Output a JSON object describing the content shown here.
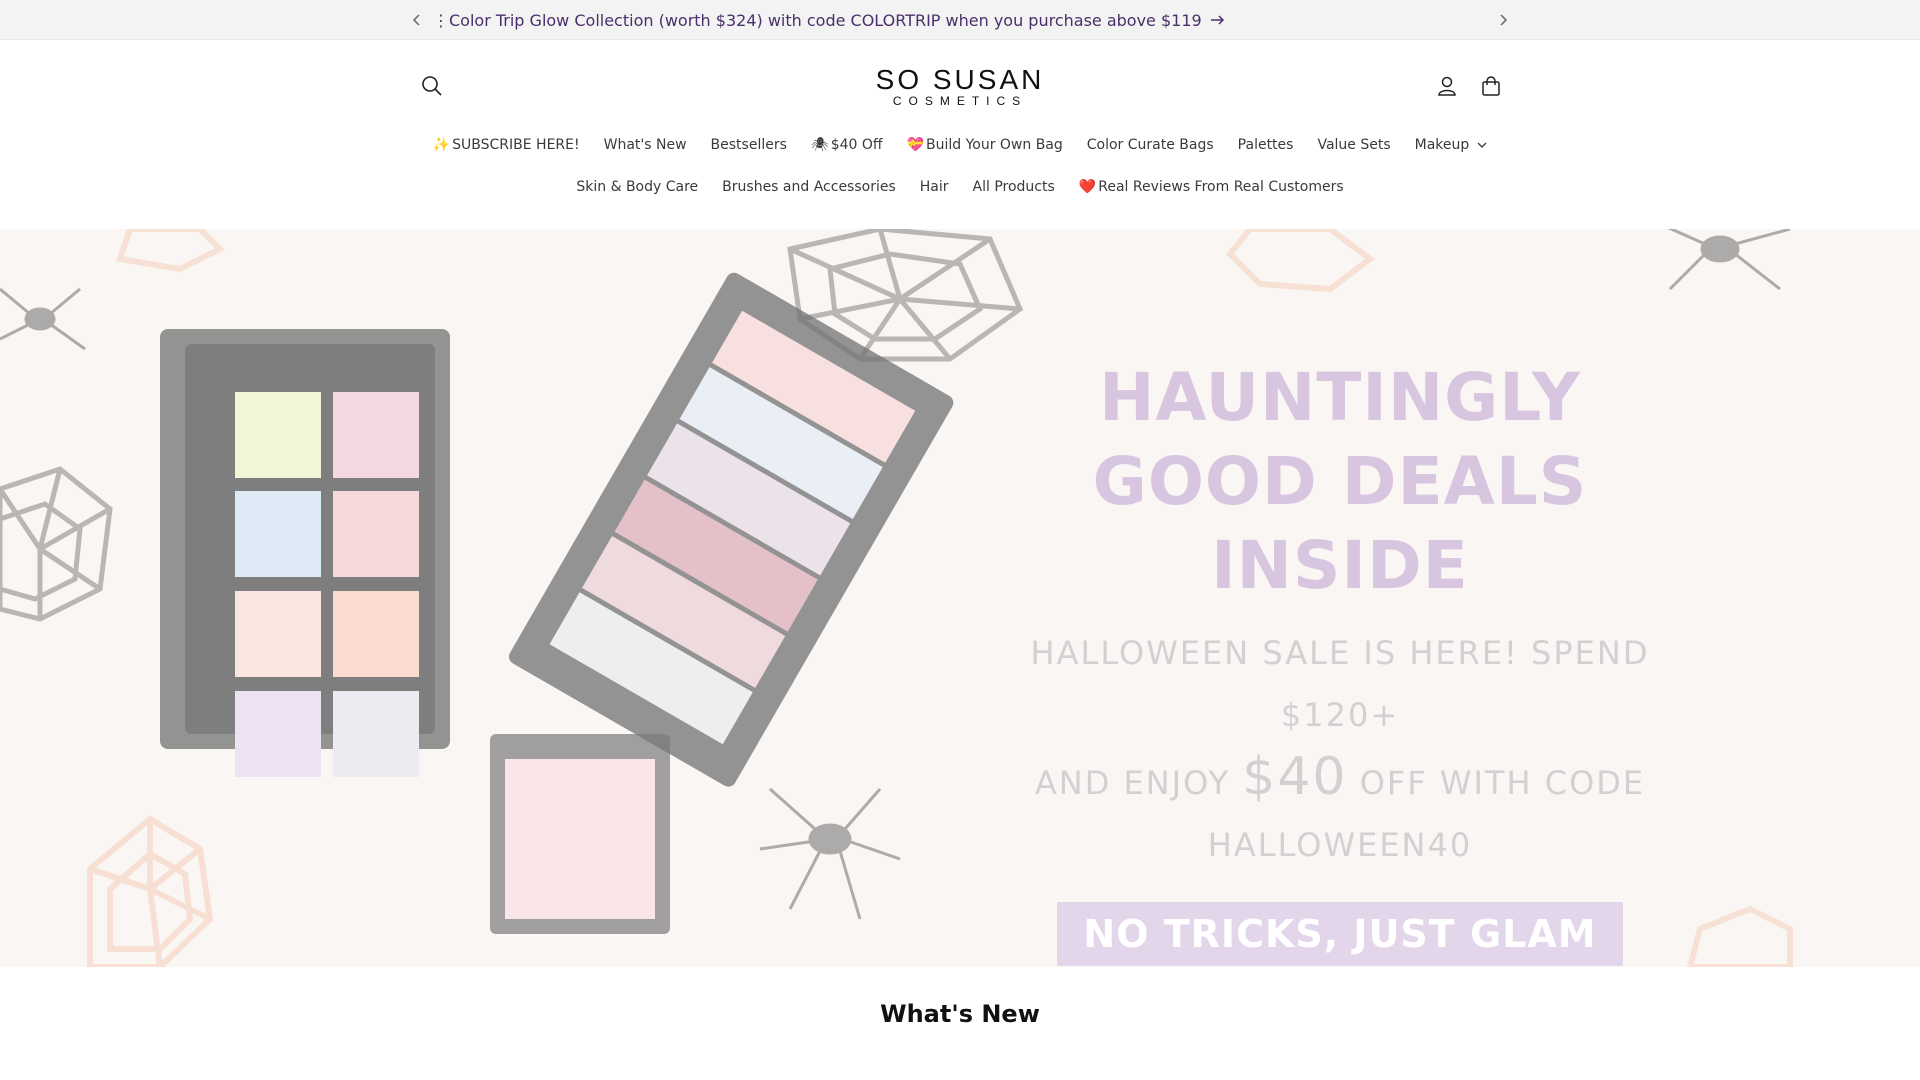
{
  "announcement": {
    "text": "⋮Color Trip Glow Collection (worth $324) with code COLORTRIP when you purchase above $119"
  },
  "header": {
    "logo_main": "SO SUSAN",
    "logo_sub": "COSMETICS"
  },
  "nav": {
    "row1": [
      {
        "emoji": "✨",
        "label": "SUBSCRIBE HERE!"
      },
      {
        "emoji": "",
        "label": "What's New"
      },
      {
        "emoji": "",
        "label": "Bestsellers"
      },
      {
        "emoji": "🕷",
        "label": "$40 Off"
      },
      {
        "emoji": "💝",
        "label": "Build Your Own Bag"
      },
      {
        "emoji": "",
        "label": "Color Curate Bags"
      },
      {
        "emoji": "",
        "label": "Palettes"
      },
      {
        "emoji": "",
        "label": "Value Sets"
      },
      {
        "emoji": "",
        "label": "Makeup"
      }
    ],
    "row2": [
      {
        "emoji": "",
        "label": "Skin & Body Care"
      },
      {
        "emoji": "",
        "label": "Brushes and Accessories"
      },
      {
        "emoji": "",
        "label": "Hair"
      },
      {
        "emoji": "",
        "label": "All Products"
      },
      {
        "emoji": "❤️",
        "label": "Real Reviews From Real Customers"
      }
    ]
  },
  "hero": {
    "headline_line1": "HAUNTINGLY",
    "headline_line2": "GOOD DEALS INSIDE",
    "body_line1": "HALLOWEEN SALE IS HERE! SPEND $120+",
    "body_line2_pre": "AND ENJOY",
    "body_line2_big": "$40",
    "body_line2_post": "OFF WITH CODE",
    "body_line3": "HALLOWEEN40",
    "cta": "NO TRICKS, JUST GLAM"
  },
  "section": {
    "title": "What's New"
  },
  "colors": {
    "announce_text": "#4a2f6a",
    "hero_headline": "#d8c5df",
    "cta_bg": "#e3d6ea"
  }
}
